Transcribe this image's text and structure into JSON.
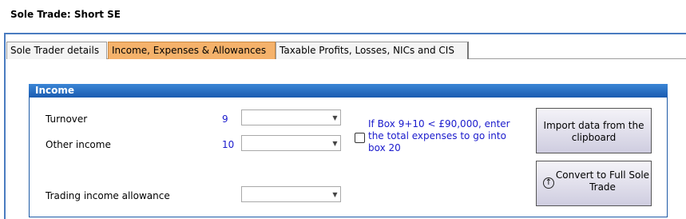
{
  "window": {
    "title": "Sole Trade: Short SE"
  },
  "tabs": [
    {
      "label": "Sole Trader details",
      "active": false
    },
    {
      "label": "Income, Expenses & Allowances",
      "active": true
    },
    {
      "label": "Taxable Profits, Losses, NICs and CIS",
      "active": false
    }
  ],
  "income_group": {
    "title": "Income",
    "fields": [
      {
        "label": "Turnover",
        "box": "9",
        "value": ""
      },
      {
        "label": "Other income",
        "box": "10",
        "value": ""
      },
      {
        "label": "Trading income allowance",
        "box": "",
        "value": ""
      }
    ],
    "expenses_hint": "If Box 9+10 < £90,000, enter the total expenses to go into box 20",
    "expenses_checkbox_checked": false
  },
  "buttons": {
    "import": "Import data from the clipboard",
    "convert": "Convert to Full Sole Trade"
  },
  "colors": {
    "active_tab": "#f5b26b",
    "group_header": "#1a5bb0",
    "box_number": "#1a1acc"
  },
  "icons": {
    "combo_arrow": "chevron-down-icon",
    "convert": "upload-arrow-icon"
  }
}
